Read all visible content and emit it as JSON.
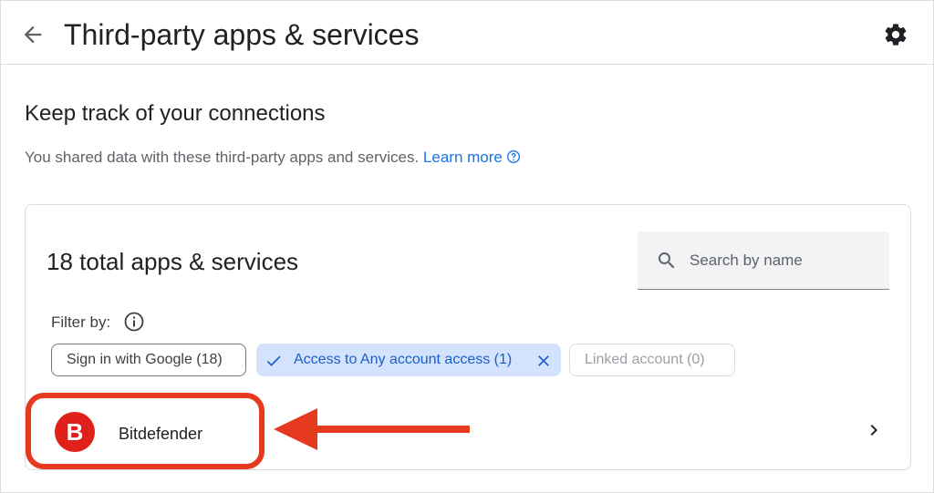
{
  "header": {
    "title": "Third-party apps & services",
    "back_icon": "arrow-left-icon",
    "settings_icon": "gear-icon"
  },
  "intro": {
    "heading": "Keep track of your connections",
    "description": "You shared data with these third-party apps and services.",
    "learn_more": "Learn more"
  },
  "panel": {
    "total": "18 total apps & services",
    "search_placeholder": "Search by name",
    "filter_label": "Filter by:",
    "chips": [
      {
        "label": "Sign in with Google (18)",
        "selected": false
      },
      {
        "label": "Access to Any account access (1)",
        "selected": true
      },
      {
        "label": "Linked account (0)",
        "selected": false,
        "disabled": true
      }
    ]
  },
  "apps": [
    {
      "name": "Bitdefender",
      "logo_letter": "B",
      "logo_color": "#e0201b"
    }
  ],
  "colors": {
    "accent": "#1a73e8",
    "selected_chip_bg": "#d3e3fd",
    "annotation": "#e63a20"
  }
}
